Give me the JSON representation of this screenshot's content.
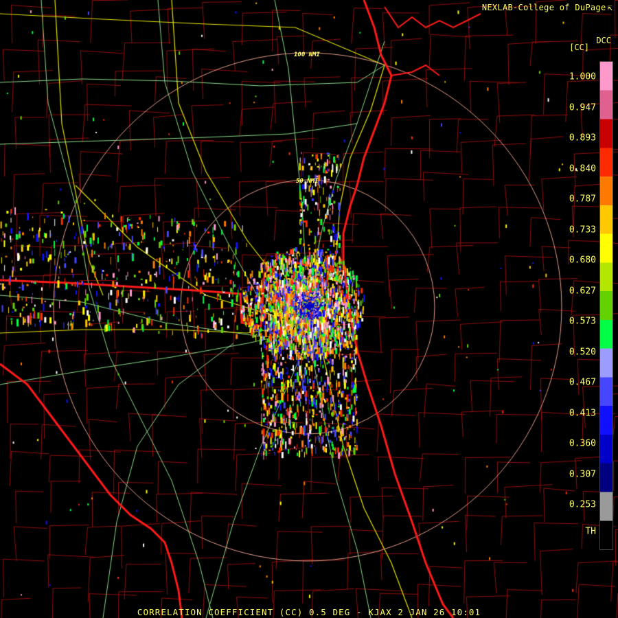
{
  "credit": {
    "text": "NEXLAB-College of DuPage",
    "cursor_icon": "cursor-arrow-icon"
  },
  "legend": {
    "product": "DCC",
    "unit": "[CC]",
    "ticks": [
      "1.000",
      "0.947",
      "0.893",
      "0.840",
      "0.787",
      "0.733",
      "0.680",
      "0.627",
      "0.573",
      "0.520",
      "0.467",
      "0.413",
      "0.360",
      "0.307",
      "0.253",
      "TH"
    ],
    "colors": [
      "#ff99cc",
      "#e06090",
      "#c80000",
      "#ff2a00",
      "#ff7a00",
      "#ffc800",
      "#ffff00",
      "#b4e600",
      "#64d200",
      "#00ff44",
      "#9c9cff",
      "#4646ff",
      "#1010ff",
      "#0000c8",
      "#000080",
      "#9a9a9a",
      "#000000"
    ]
  },
  "range_rings": {
    "inner_label": "50 NMI",
    "outer_label": "100 NMI"
  },
  "footer": {
    "title": "CORRELATION COEFFICIENT (CC) 0.5 DEG - KJAX 2 JAN 26 10:01"
  },
  "palette": {
    "background": "#000000",
    "state_border": "#ff1a1a",
    "county_lines": "#aa1010",
    "roads_yellow": "#e6e600",
    "roads_green": "#8cdc8c",
    "range_ring": "#e6a08c",
    "text": "#ffff66"
  }
}
